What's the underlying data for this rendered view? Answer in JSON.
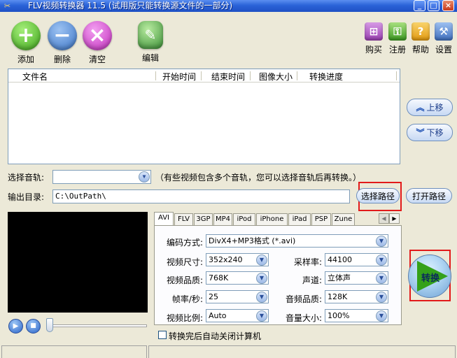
{
  "window": {
    "title": "FLV视频转换器 11.5 (试用版只能转换源文件的一部分)",
    "app_icon": "scissors-icon"
  },
  "toolbar": {
    "add": "添加",
    "delete": "删除",
    "clear": "清空",
    "edit": "编辑",
    "buy": "购买",
    "register": "注册",
    "help": "帮助",
    "settings": "设置"
  },
  "file_list": {
    "columns": [
      "文件名",
      "开始时间",
      "结束时间",
      "图像大小",
      "转换进度"
    ],
    "rows": []
  },
  "side_buttons": {
    "move_up": "上移",
    "move_down": "下移"
  },
  "audio_track": {
    "label": "选择音轨:",
    "value": "",
    "hint": "（有些视频包含多个音轨，您可以选择音轨后再转换。）"
  },
  "output": {
    "label": "输出目录:",
    "path": "C:\\OutPath\\",
    "choose_button": "选择路径",
    "open_button": "打开路径"
  },
  "format_tabs": [
    "AVI",
    "FLV",
    "3GP",
    "MP4",
    "iPod",
    "iPhone",
    "iPad",
    "PSP",
    "Zune"
  ],
  "active_tab": "AVI",
  "settings": {
    "codec_label": "编码方式:",
    "codec_value": "DivX4+MP3格式 (*.avi)",
    "size_label": "视频尺寸:",
    "size_value": "352x240",
    "vquality_label": "视频品质:",
    "vquality_value": "768K",
    "fps_label": "帧率/秒:",
    "fps_value": "25",
    "ratio_label": "视频比例:",
    "ratio_value": "Auto",
    "samplerate_label": "采样率:",
    "samplerate_value": "44100",
    "channel_label": "声道:",
    "channel_value": "立体声",
    "aquality_label": "音频品质:",
    "aquality_value": "128K",
    "volume_label": "音量大小:",
    "volume_value": "100%"
  },
  "convert_button": "转换",
  "auto_shutdown": {
    "label": "转换完后自动关闭计算机",
    "checked": false
  },
  "colors": {
    "titlebar": "#2b63d8",
    "highlight": "#e21a1a",
    "convert": "#3fa61a"
  }
}
